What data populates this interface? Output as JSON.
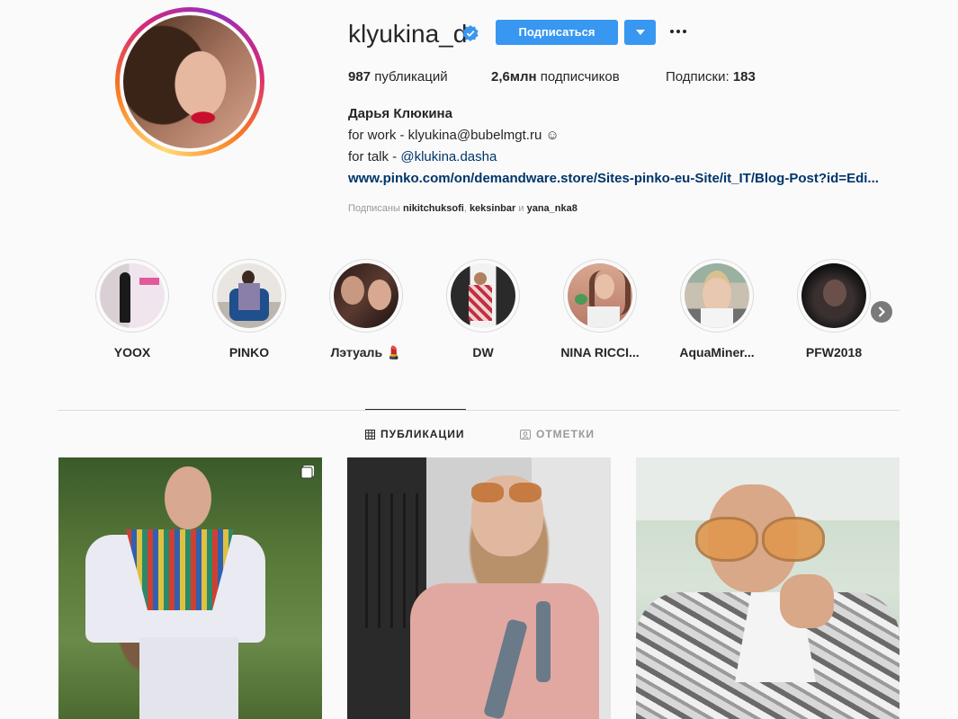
{
  "profile": {
    "username": "klyukina_d",
    "follow_label": "Подписаться",
    "stats": {
      "posts_count": "987",
      "posts_label": "публикаций",
      "followers_count": "2,6млн",
      "followers_label": "подписчиков",
      "following_label": "Подписки:",
      "following_count": "183"
    },
    "full_name": "Дарья Клюкина",
    "bio_line1": "for work - klyukina@bubelmgt.ru ☺",
    "bio_line2_prefix": "for talk - ",
    "bio_line2_link": "@klukina.dasha",
    "website": "www.pinko.com/on/demandware.store/Sites-pinko-eu-Site/it_IT/Blog-Post?id=Edi...",
    "followed_by": {
      "prefix": "Подписаны",
      "user1": "nikitchuksofi",
      "sep1": ",",
      "user2": "keksinbar",
      "and": "и",
      "user3": "yana_nka8"
    }
  },
  "highlights": [
    {
      "label": "YOOX"
    },
    {
      "label": "PINKO"
    },
    {
      "label": "Лэтуаль 💄"
    },
    {
      "label": "DW"
    },
    {
      "label": "NINA RICCI..."
    },
    {
      "label": "AquaMiner..."
    },
    {
      "label": "PFW2018"
    }
  ],
  "tabs": {
    "posts": "ПУБЛИКАЦИИ",
    "tagged": "ОТМЕТКИ"
  },
  "colors": {
    "accent": "#3897f0",
    "link": "#003569",
    "verified": "#3897f0",
    "lipstick": "#c8102e"
  }
}
